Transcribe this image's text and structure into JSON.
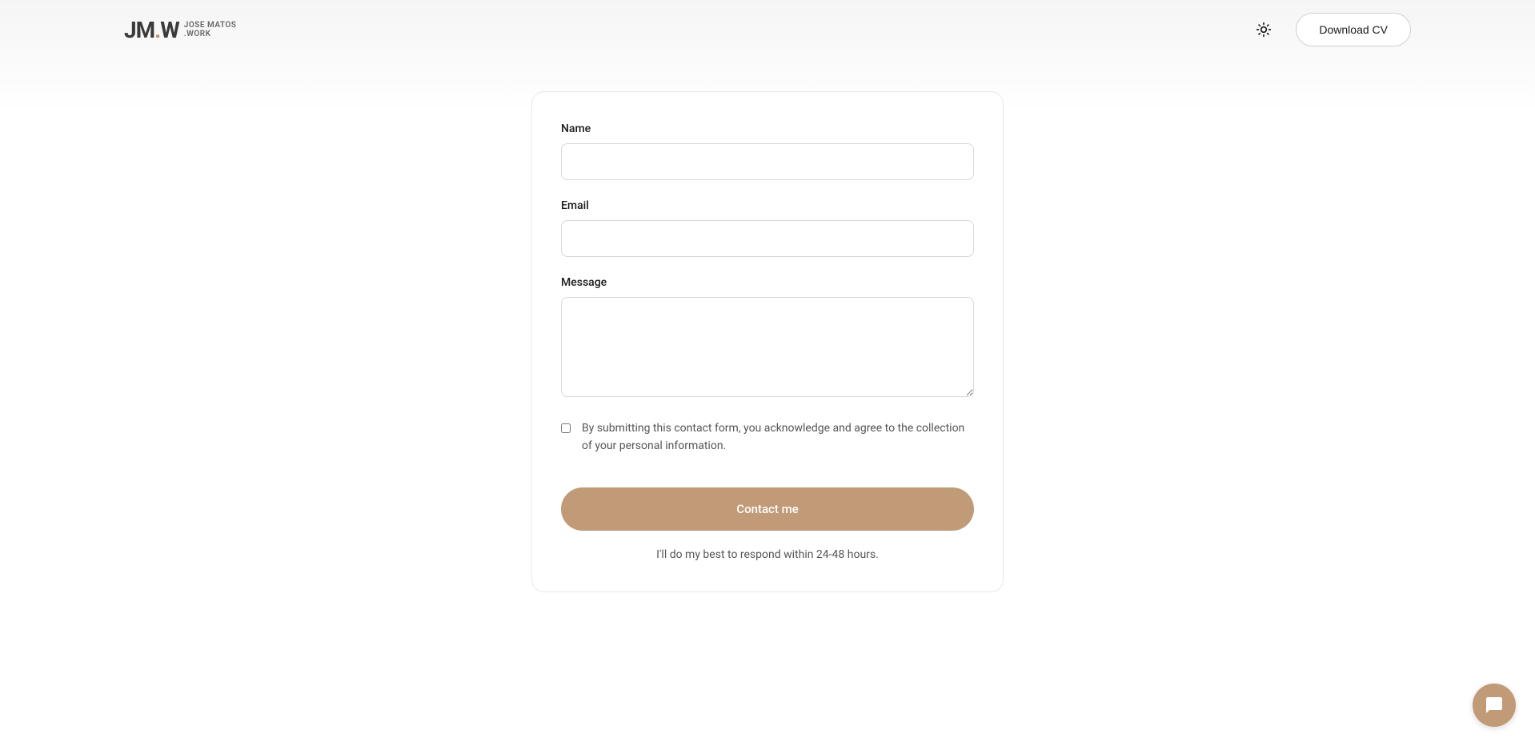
{
  "header": {
    "logo": {
      "main": "JM.W",
      "line1": "JOSE MATOS",
      "line2": ".WORK"
    },
    "download_cv_label": "Download CV"
  },
  "form": {
    "name_label": "Name",
    "email_label": "Email",
    "message_label": "Message",
    "consent_text": "By submitting this contact form, you acknowledge and agree to the collection of your personal information.",
    "submit_label": "Contact me",
    "response_note": "I'll do my best to respond within 24-48 hours."
  },
  "colors": {
    "accent": "#c19a77"
  }
}
